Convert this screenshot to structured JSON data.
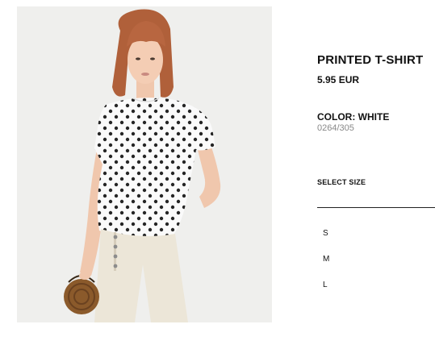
{
  "product": {
    "name": "PRINTED T-SHIRT",
    "price": "5.95 EUR",
    "color_label": "COLOR: WHITE",
    "reference": "0264/305"
  },
  "size_selector": {
    "title": "SELECT SIZE",
    "sizes": [
      "S",
      "M",
      "L"
    ]
  },
  "colors": {
    "image_background": "#efefed",
    "text": "#111111",
    "muted_text": "#888888",
    "divider": "#222222"
  }
}
